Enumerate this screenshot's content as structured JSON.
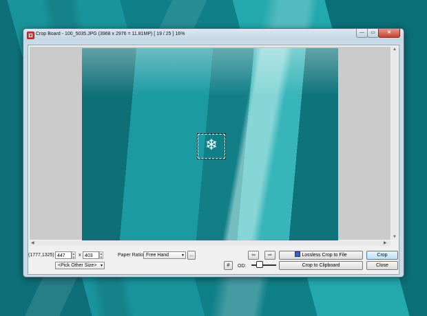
{
  "window": {
    "title": "Crop Board  -  100_5035.JPG  (3968 x 2976 = 11.81MP)  [ 19 / 25 ]  16%",
    "min_label": "—",
    "max_label": "▭",
    "close_label": "✕"
  },
  "toolbar": {
    "coords": "(1777,1325)",
    "width_value": "447",
    "x_label": "x",
    "height_value": "403",
    "pick_size": "<Pick Other Size>",
    "paper_ratio_label": "Paper Ratio:",
    "paper_ratio_value": "Free Hand",
    "more_label": "...",
    "prev_label": "⇦",
    "next_label": "⇨",
    "lossless_label": "Lossless Crop to File",
    "crop_label": "Crop",
    "grid_label": "#",
    "od_label": "OD:",
    "clipboard_label": "Crop to Clipboard",
    "close_label": "Close"
  },
  "colors": {
    "accent": "#3c7fb1",
    "desktop": "#1b9aa2"
  },
  "icons": {
    "app": "crop-app-icon",
    "selection_glyph": "❄"
  }
}
